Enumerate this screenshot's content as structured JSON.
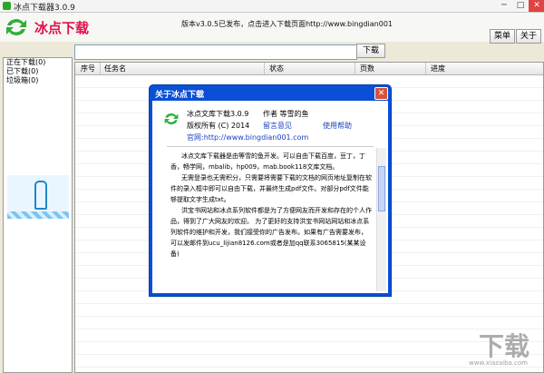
{
  "window": {
    "title": "冰点下载器3.0.9",
    "min": "─",
    "max": "□",
    "close": "✕"
  },
  "header": {
    "brand": "冰点下载",
    "announcement": "版本v3.0.5已发布，点击进入下载页面http://www.bingdian001",
    "menu_label": "菜单",
    "about_label": "关于"
  },
  "search": {
    "value": "",
    "download_label": "下载"
  },
  "sidebar": {
    "items": [
      {
        "label": "正在下载(0)"
      },
      {
        "label": "已下载(0)"
      },
      {
        "label": "垃圾箱(0)"
      }
    ]
  },
  "table": {
    "columns": [
      "序号",
      "任务名",
      "状态",
      "页数",
      "进度"
    ]
  },
  "dialog": {
    "title": "关于冰点下载",
    "product": "冰点文库下载3.0.9",
    "author": "作者 等雪的鱼",
    "copyright": "版权所有 (C) 2014",
    "feedback": "留言意见",
    "help": "使用帮助",
    "website": "官网:http://www.bingdian001.com",
    "paragraphs": [
      "冰点文库下载器是由等雪的鱼开发。可以自由下载百度，豆丁，丁香，畅学网，mbalib，hp009，mab.book118文库文档。",
      "无需登录也无需积分，只需要将需要下载的文档的网页地址复制在软件的录入框中即可以自由下载，并最终生成pdf文件。对部分pdf文件能够提取文字生成txt。",
      "洪宝书网站和冰点系列软件都是为了方便网友而开发和存在的个人作品，得到了广大网友的欢迎。 为了更好的支持洪宝书网站网站和冰点系列软件的维护和开发，我们接受你的广告发布。如果有广告需要发布，可以发邮件到ucu_lijian8126.com或者是加qq联系3065815(某某设备)"
    ]
  },
  "watermark": {
    "text": "下载",
    "sub": "www.xiazaiba.com"
  }
}
